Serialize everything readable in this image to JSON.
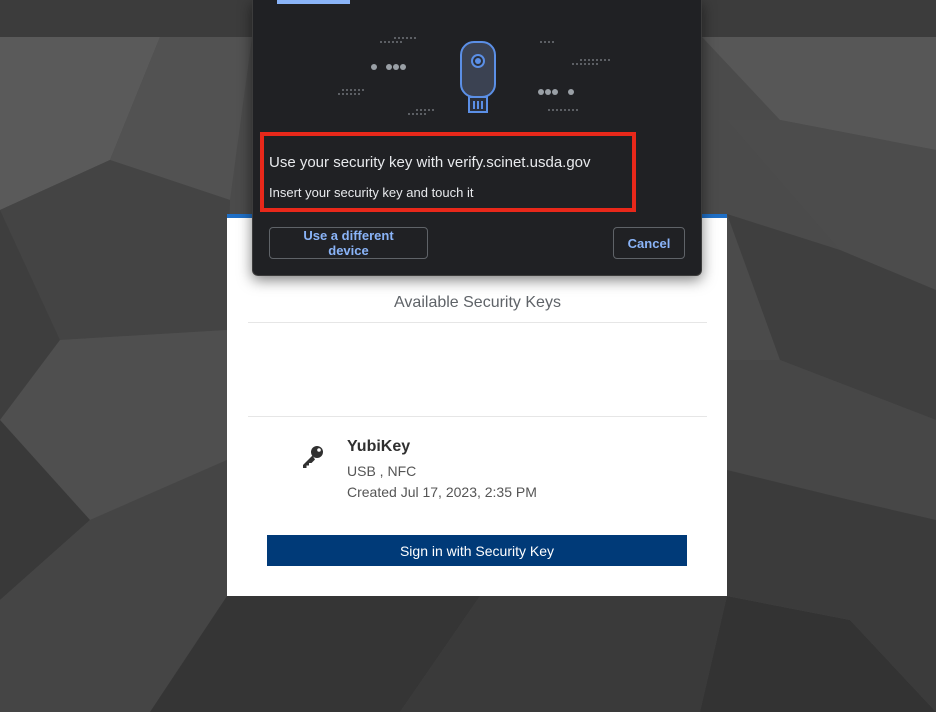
{
  "dialog": {
    "title": "Use your security key with verify.scinet.usda.gov",
    "subtitle": "Insert your security key and touch it",
    "different_device_label": "Use a different device",
    "cancel_label": "Cancel",
    "highlight_color": "#e8281a",
    "accent_color": "#8ab4f8"
  },
  "page": {
    "section_title": "Available Security Keys",
    "key": {
      "name": "YubiKey",
      "transports": "USB , NFC",
      "created": "Created Jul 17, 2023, 2:35 PM",
      "icon": "key-icon"
    },
    "signin_label": "Sign in with Security Key",
    "brand_color": "#003a78",
    "top_border_color": "#1f6fc6"
  }
}
